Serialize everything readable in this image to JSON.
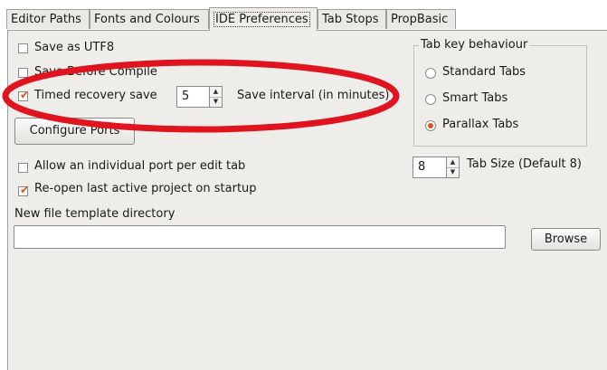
{
  "tabs": [
    {
      "label": "Editor Paths",
      "active": false
    },
    {
      "label": "Fonts and Colours",
      "active": false
    },
    {
      "label": "IDE Preferences",
      "active": true
    },
    {
      "label": "Tab Stops",
      "active": false
    },
    {
      "label": "PropBasic",
      "active": false
    }
  ],
  "options": {
    "save_utf8": {
      "label": "Save as UTF8",
      "checked": false
    },
    "save_before_compile": {
      "label": "Save Before Compile",
      "checked": false
    },
    "timed_recovery": {
      "label": "Timed recovery save",
      "checked": true
    },
    "recovery_interval": {
      "value": "5",
      "label": "Save interval (in minutes)"
    },
    "configure_ports": {
      "label": "Configure Ports"
    },
    "port_per_tab": {
      "label": "Allow an individual port per edit tab",
      "checked": false
    },
    "reopen_project": {
      "label": "Re-open last active project on startup",
      "checked": true
    }
  },
  "tab_key": {
    "title": "Tab key behaviour",
    "choices": [
      {
        "label": "Standard Tabs",
        "selected": false
      },
      {
        "label": "Smart Tabs",
        "selected": false
      },
      {
        "label": "Parallax Tabs",
        "selected": true
      }
    ],
    "tab_size": {
      "value": "8",
      "label": "Tab Size (Default 8)"
    }
  },
  "template": {
    "label": "New file template directory",
    "value": "",
    "browse_label": "Browse"
  },
  "colors": {
    "accent": "#d9541d",
    "annotation": "#e0141e"
  }
}
